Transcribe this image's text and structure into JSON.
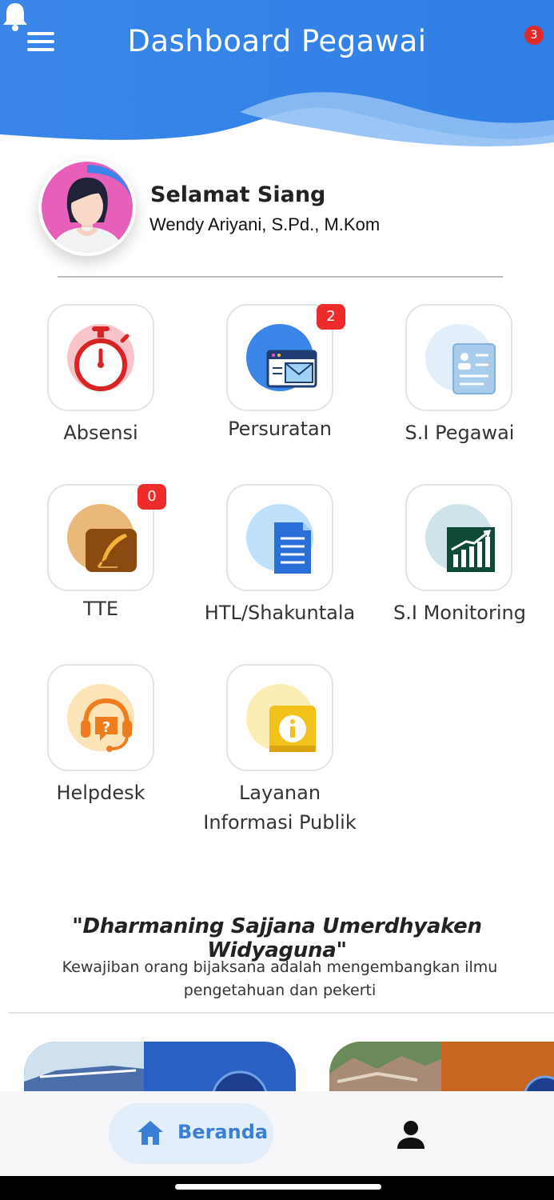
{
  "header": {
    "title": "Dashboard Pegawai",
    "notification_count": "3"
  },
  "greeting": {
    "salutation": "Selamat Siang",
    "user_name": "Wendy Ariyani, S.Pd., M.Kom"
  },
  "menu": [
    {
      "label": "Absensi",
      "icon": "stopwatch-icon"
    },
    {
      "label": "Persuratan",
      "icon": "mail-window-icon",
      "badge": "2"
    },
    {
      "label": "S.I Pegawai",
      "icon": "id-card-icon"
    },
    {
      "label": "TTE",
      "icon": "quill-pen-icon",
      "badge": "0"
    },
    {
      "label": "HTL/Shakuntala",
      "icon": "document-icon"
    },
    {
      "label": "S.I Monitoring",
      "icon": "chart-board-icon"
    },
    {
      "label": "Helpdesk",
      "icon": "headset-icon"
    },
    {
      "label": "Layanan",
      "label2": "Informasi Publik",
      "icon": "info-icon"
    }
  ],
  "quote": {
    "text": "\"Dharmaning Sajjana Umerdhyaken Widyaguna\"",
    "line1": "Kewajiban orang bijaksana adalah mengembangkan ilmu",
    "line2": "pengetahuan dan pekerti"
  },
  "bottom_nav": {
    "home_label": "Beranda",
    "home_icon": "home-icon",
    "profile_icon": "person-icon"
  },
  "colors": {
    "primary": "#3a86e8",
    "badge": "#ee2b2b",
    "nav_active_bg": "#e3eefb"
  }
}
